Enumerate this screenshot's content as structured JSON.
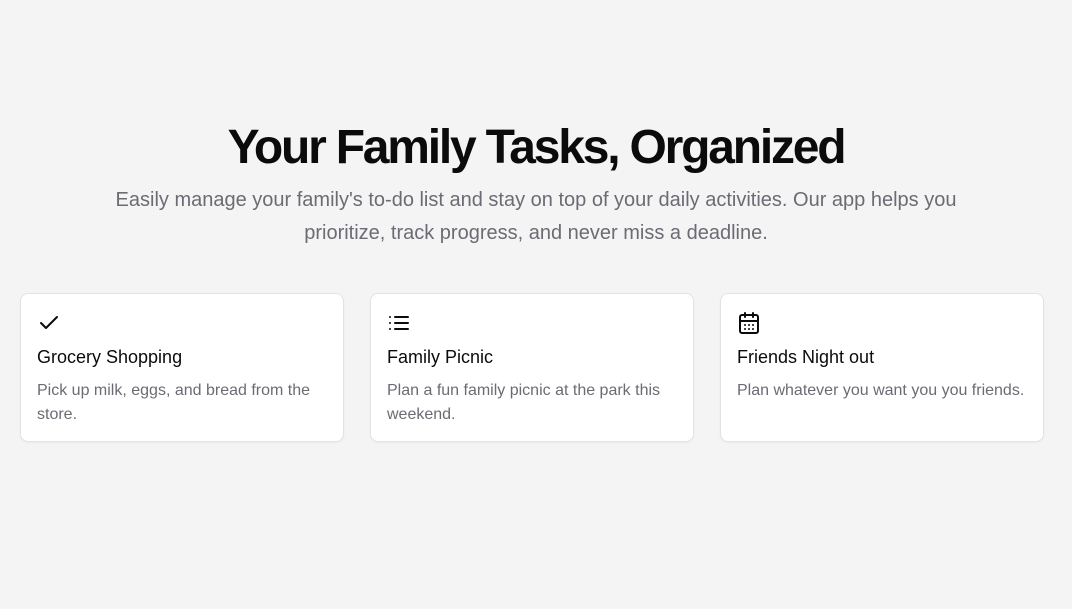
{
  "hero": {
    "title": "Your Family Tasks, Organized",
    "subtitle": "Easily manage your family's to-do list and stay on top of your daily activities. Our app helps you prioritize, track progress, and never miss a deadline."
  },
  "cards": [
    {
      "icon": "check-icon",
      "title": "Grocery Shopping",
      "description": "Pick up milk, eggs, and bread from the store."
    },
    {
      "icon": "list-icon",
      "title": "Family Picnic",
      "description": "Plan a fun family picnic at the park this weekend."
    },
    {
      "icon": "calendar-icon",
      "title": "Friends Night out",
      "description": "Plan whatever you want you you friends."
    }
  ],
  "colors": {
    "background": "#f4f4f4",
    "card_background": "#ffffff",
    "heading": "#0b0b0b",
    "muted_text": "#6b6b74",
    "card_border": "#e3e3e6"
  }
}
